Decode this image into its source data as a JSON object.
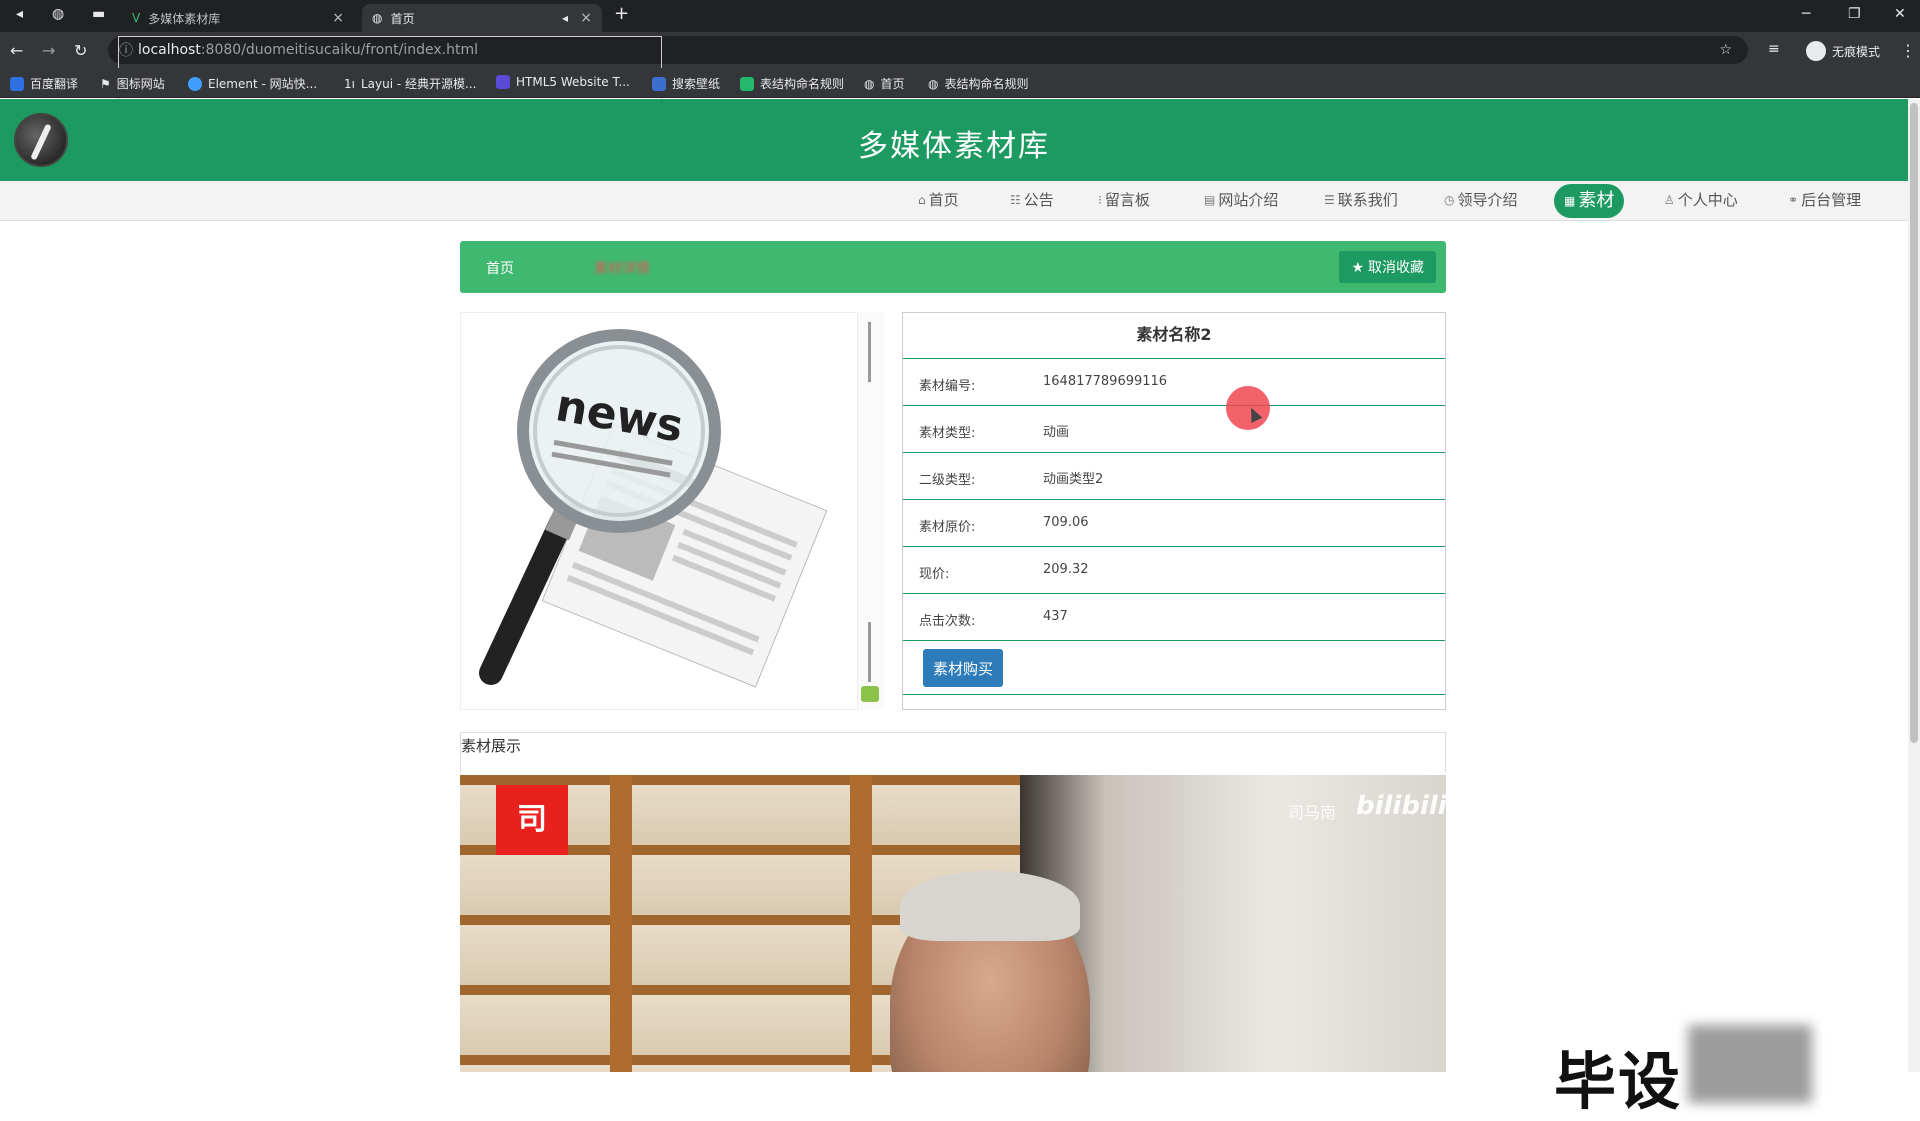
{
  "browser": {
    "tabs": [
      {
        "title": "多媒体素材库",
        "active": false
      },
      {
        "title": "首页",
        "active": true
      }
    ],
    "url_host": "localhost",
    "url_path": ":8080/duomeitisucaiku/front/index.html",
    "profile_label": "无痕模式",
    "bookmarks": [
      "百度翻译",
      "图标网站",
      "Element - 网站快...",
      "Layui - 经典开源模...",
      "HTML5 Website T...",
      "搜索壁纸",
      "表结构命名规则",
      "首页",
      "表结构命名规则"
    ]
  },
  "header": {
    "title": "多媒体素材库"
  },
  "nav": {
    "items": [
      "首页",
      "公告",
      "留言板",
      "网站介绍",
      "联系我们",
      "领导介绍",
      "素材",
      "个人中心",
      "后台管理"
    ],
    "active_index": 6
  },
  "breadcrumb": {
    "home": "首页",
    "current": "素材详情"
  },
  "favorite_button": "取消收藏",
  "detail": {
    "name": "素材名称2",
    "rows": [
      {
        "label": "素材编号:",
        "value": "1648177896991​16"
      },
      {
        "label": "素材类型:",
        "value": "动画"
      },
      {
        "label": "二级类型:",
        "value": "动画类型2"
      },
      {
        "label": "素材原价:",
        "value": "709.06"
      },
      {
        "label": "现价:",
        "value": "209.32"
      },
      {
        "label": "点击次数:",
        "value": "437"
      }
    ],
    "buy_button": "素材购买"
  },
  "showcase": {
    "label": "素材展示"
  },
  "video": {
    "logo_char": "司",
    "uploader": "司马南",
    "platform": "bilibili"
  },
  "watermark": "毕设"
}
